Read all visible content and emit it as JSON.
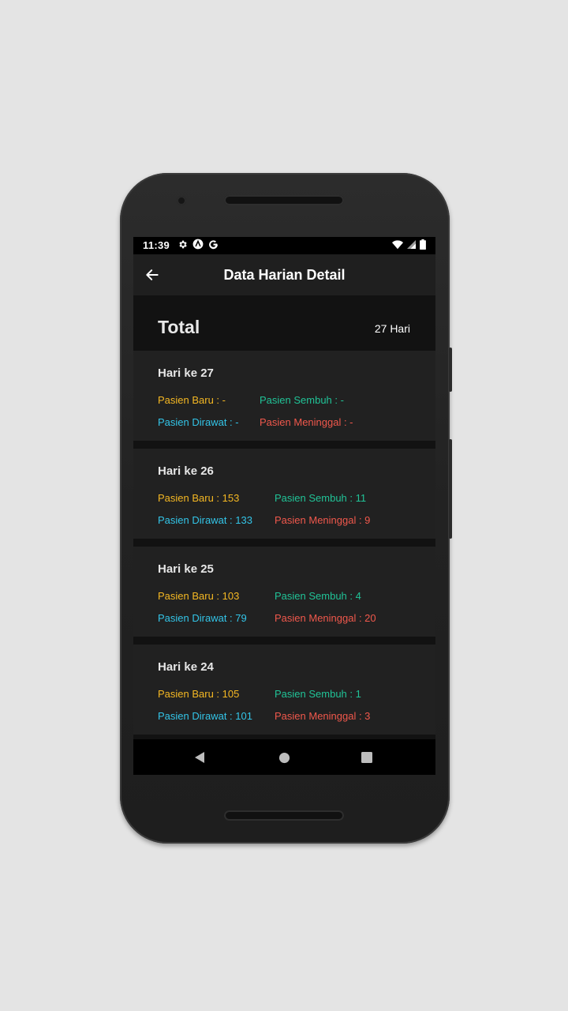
{
  "status": {
    "time": "11:39"
  },
  "appbar": {
    "title": "Data Harian Detail"
  },
  "total": {
    "label": "Total",
    "days": "27 Hari"
  },
  "colors": {
    "baru": "#f5b823",
    "sembuh": "#21c397",
    "dirawat": "#33c5e8",
    "meninggal": "#f0584c"
  },
  "days": [
    {
      "title": "Hari ke 27",
      "baru": "Pasien Baru : -",
      "sembuh": "Pasien Sembuh : -",
      "dirawat": "Pasien Dirawat : -",
      "meninggal": "Pasien Meninggal : -"
    },
    {
      "title": "Hari ke 26",
      "baru": "Pasien Baru : 153",
      "sembuh": "Pasien Sembuh : 11",
      "dirawat": "Pasien Dirawat : 133",
      "meninggal": "Pasien Meninggal : 9"
    },
    {
      "title": "Hari ke 25",
      "baru": "Pasien Baru : 103",
      "sembuh": "Pasien Sembuh : 4",
      "dirawat": "Pasien Dirawat : 79",
      "meninggal": "Pasien Meninggal : 20"
    },
    {
      "title": "Hari ke 24",
      "baru": "Pasien Baru : 105",
      "sembuh": "Pasien Sembuh : 1",
      "dirawat": "Pasien Dirawat : 101",
      "meninggal": "Pasien Meninggal : 3"
    }
  ],
  "icons": {
    "back": "arrow-left-icon",
    "nav_back": "triangle-back-icon",
    "nav_home": "circle-home-icon",
    "nav_recents": "square-recents-icon"
  }
}
